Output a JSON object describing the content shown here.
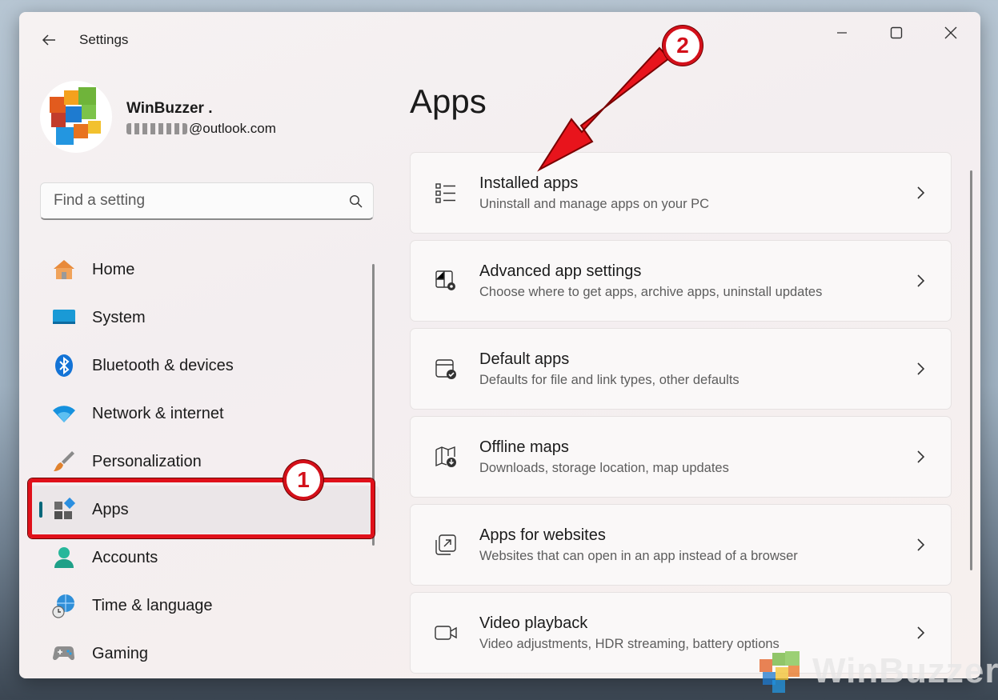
{
  "window": {
    "title": "Settings"
  },
  "profile": {
    "name": "WinBuzzer .",
    "email_suffix": "@outlook.com"
  },
  "search": {
    "placeholder": "Find a setting"
  },
  "sidebar": {
    "items": [
      {
        "label": "Home",
        "icon": "home-icon"
      },
      {
        "label": "System",
        "icon": "system-icon"
      },
      {
        "label": "Bluetooth & devices",
        "icon": "bluetooth-icon"
      },
      {
        "label": "Network & internet",
        "icon": "wifi-icon"
      },
      {
        "label": "Personalization",
        "icon": "brush-icon"
      },
      {
        "label": "Apps",
        "icon": "apps-icon",
        "active": true
      },
      {
        "label": "Accounts",
        "icon": "accounts-icon"
      },
      {
        "label": "Time & language",
        "icon": "globe-clock-icon"
      },
      {
        "label": "Gaming",
        "icon": "gamepad-icon"
      }
    ]
  },
  "main": {
    "title": "Apps",
    "cards": [
      {
        "title": "Installed apps",
        "subtitle": "Uninstall and manage apps on your PC",
        "icon": "list-icon"
      },
      {
        "title": "Advanced app settings",
        "subtitle": "Choose where to get apps, archive apps, uninstall updates",
        "icon": "app-settings-icon"
      },
      {
        "title": "Default apps",
        "subtitle": "Defaults for file and link types, other defaults",
        "icon": "default-apps-icon"
      },
      {
        "title": "Offline maps",
        "subtitle": "Downloads, storage location, map updates",
        "icon": "map-download-icon"
      },
      {
        "title": "Apps for websites",
        "subtitle": "Websites that can open in an app instead of a browser",
        "icon": "open-external-icon"
      },
      {
        "title": "Video playback",
        "subtitle": "Video adjustments, HDR streaming, battery options",
        "icon": "video-camera-icon"
      }
    ]
  },
  "annotations": {
    "step1": "1",
    "step2": "2",
    "accent": "#e0101a"
  },
  "watermark": {
    "text": "WinBuzzer"
  }
}
